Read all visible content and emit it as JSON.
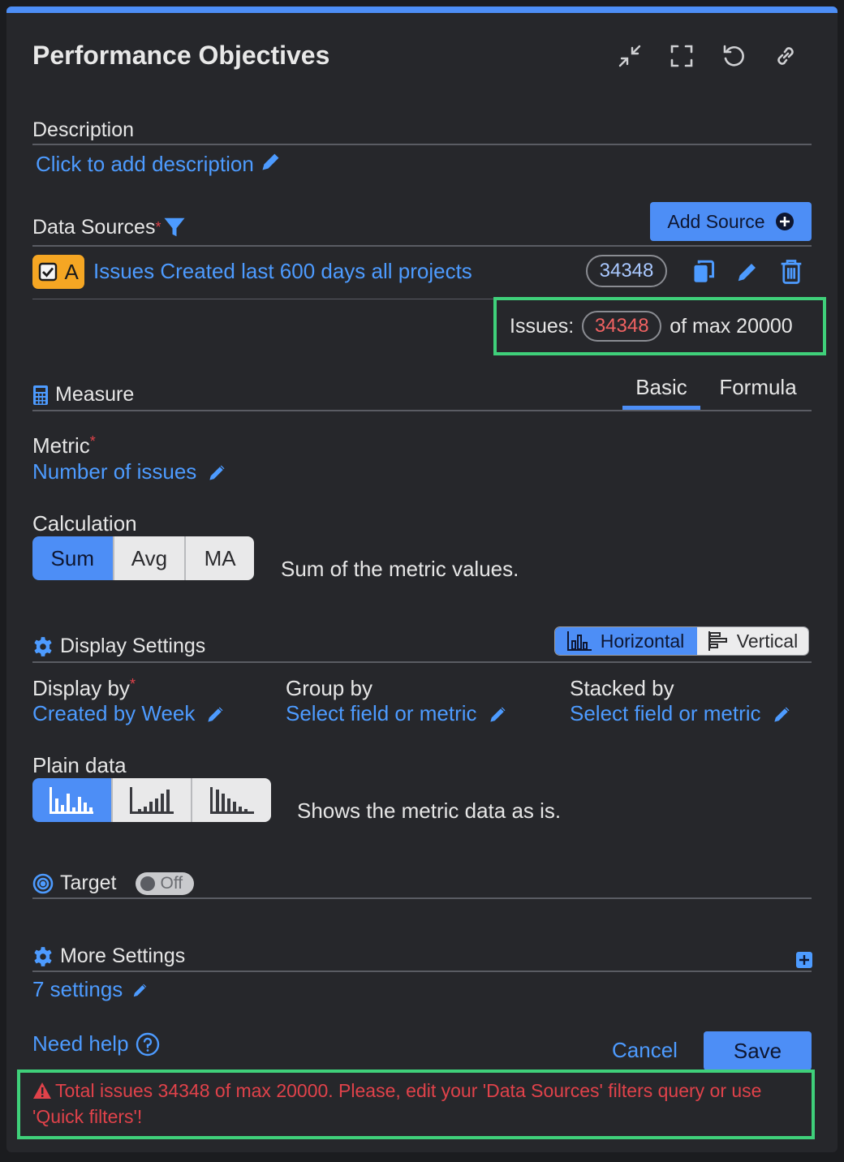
{
  "header": {
    "title": "Performance Objectives",
    "icons": [
      "collapse-icon",
      "fullscreen-icon",
      "reset-icon",
      "link-icon"
    ]
  },
  "description": {
    "label": "Description",
    "link": "Click to add description"
  },
  "data_sources": {
    "label": "Data Sources",
    "required_mark": "*",
    "add_button": "Add Source",
    "source": {
      "letter": "A",
      "name": "Issues Created last 600 days all projects",
      "count": "34348"
    },
    "issues_notice": {
      "prefix": "Issues:",
      "count": "34348",
      "suffix": "of max 20000"
    }
  },
  "measure": {
    "label": "Measure",
    "tabs": [
      "Basic",
      "Formula"
    ],
    "active_tab": "Basic",
    "metric_label": "Metric",
    "metric_value": "Number of issues",
    "calculation_label": "Calculation",
    "calc_options": [
      "Sum",
      "Avg",
      "MA"
    ],
    "calc_active": "Sum",
    "calc_description": "Sum of the metric values."
  },
  "display_settings": {
    "label": "Display Settings",
    "orientation": [
      "Horizontal",
      "Vertical"
    ],
    "orientation_active": "Horizontal",
    "display_by_label": "Display by",
    "display_by_value": "Created by Week",
    "group_by_label": "Group by",
    "group_by_value": "Select field or metric",
    "stacked_by_label": "Stacked by",
    "stacked_by_value": "Select field or metric",
    "plain_data_label": "Plain data",
    "plain_data_description": "Shows the metric data as is."
  },
  "target": {
    "label": "Target",
    "toggle": "Off"
  },
  "more_settings": {
    "label": "More Settings",
    "link": "7 settings"
  },
  "footer": {
    "help": "Need help",
    "cancel": "Cancel",
    "save": "Save",
    "error": "Total issues 34348 of max 20000. Please, edit your 'Data Sources' filters query or use 'Quick filters'!"
  },
  "colors": {
    "accent": "#4d8ef6",
    "link": "#4d9bff",
    "error": "#e0424a",
    "highlight": "#3fd07a",
    "source_badge": "#f5a623"
  }
}
